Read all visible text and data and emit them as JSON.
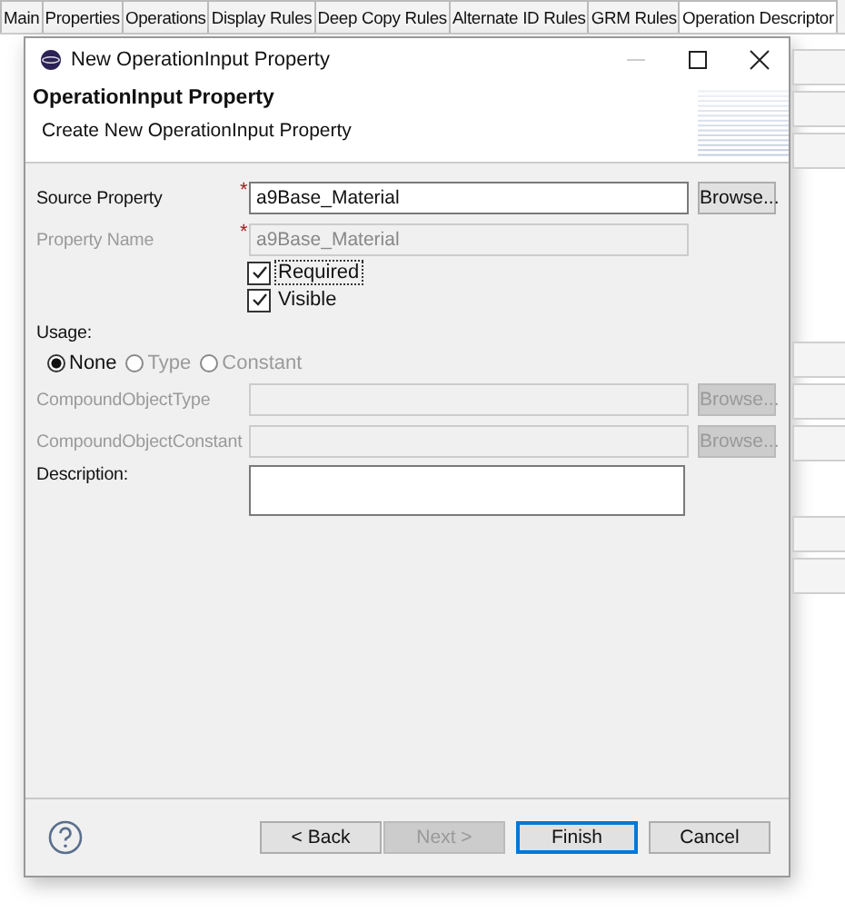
{
  "tabs": [
    {
      "label": "Main",
      "selected": false
    },
    {
      "label": "Properties",
      "selected": false
    },
    {
      "label": "Operations",
      "selected": false
    },
    {
      "label": "Display Rules",
      "selected": false
    },
    {
      "label": "Deep Copy Rules",
      "selected": false
    },
    {
      "label": "Alternate ID Rules",
      "selected": false
    },
    {
      "label": "GRM Rules",
      "selected": false
    },
    {
      "label": "Operation Descriptor",
      "selected": true
    }
  ],
  "dialog": {
    "title": "New OperationInput Property",
    "header_title": "OperationInput Property",
    "header_subtitle": "Create New OperationInput Property",
    "rows": [
      {
        "kind": "text",
        "label": "Source Property",
        "marker": "*",
        "value": "a9Base_Material",
        "disabled": false,
        "button": "Browse..."
      },
      {
        "kind": "text",
        "label": "Property Name",
        "marker": "*",
        "value": "a9Base_Material",
        "disabled": true
      },
      {
        "kind": "checkbox",
        "label": "Required",
        "checked": true,
        "focused": true
      },
      {
        "kind": "checkbox",
        "label": "Visible",
        "checked": true,
        "focused": false
      },
      {
        "kind": "heading",
        "label": "Usage:"
      },
      {
        "kind": "radios",
        "options": [
          {
            "label": "None",
            "selected": true,
            "disabled": false
          },
          {
            "label": "Type",
            "selected": false,
            "disabled": true
          },
          {
            "label": "Constant",
            "selected": false,
            "disabled": true
          }
        ]
      },
      {
        "kind": "text",
        "label": "CompoundObjectType",
        "disabled": true,
        "button": "Browse..."
      },
      {
        "kind": "text",
        "label": "CompoundObjectConstant",
        "disabled": true,
        "button": "Browse..."
      },
      {
        "kind": "textarea",
        "label": "Description:"
      }
    ],
    "buttons": [
      {
        "label": "< Back",
        "disabled": false,
        "default": false
      },
      {
        "label": "Next >",
        "disabled": true,
        "default": false
      },
      {
        "label": "Finish",
        "disabled": false,
        "default": true
      },
      {
        "label": "Cancel",
        "disabled": false,
        "default": false
      }
    ]
  }
}
